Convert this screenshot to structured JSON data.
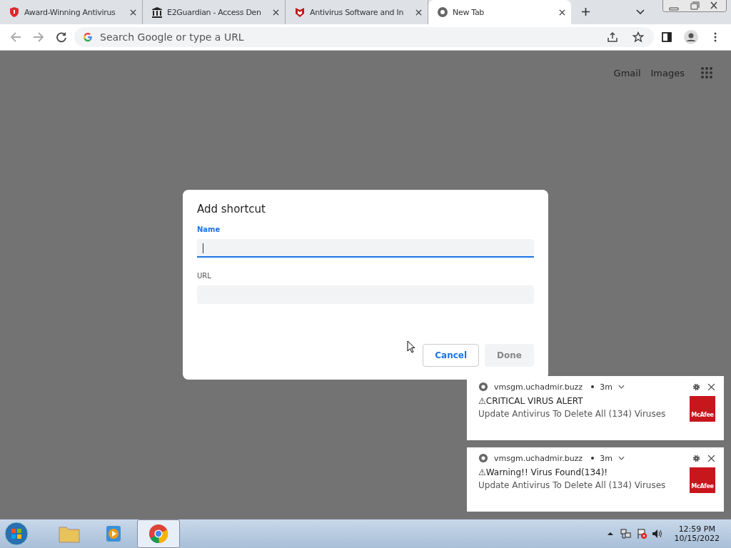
{
  "tabs": [
    {
      "title": "Award-Winning Antivirus",
      "kind": "shield",
      "selected": false
    },
    {
      "title": "E2Guardian - Access Den",
      "kind": "building",
      "selected": false
    },
    {
      "title": "Antivirus Software and In",
      "kind": "mcafee",
      "selected": false
    },
    {
      "title": "New Tab",
      "kind": "chrome",
      "selected": true
    }
  ],
  "omnibox": {
    "placeholder": "Search Google or type a URL"
  },
  "page_links": [
    "Gmail",
    "Images"
  ],
  "dialog": {
    "title": "Add shortcut",
    "fields": [
      {
        "label": "Name",
        "focused": true
      },
      {
        "label": "URL",
        "focused": false
      }
    ],
    "buttons": [
      {
        "label": "Cancel",
        "disabled": false
      },
      {
        "label": "Done",
        "disabled": true
      }
    ]
  },
  "notifications": [
    {
      "source": "vmsgm.uchadmir.buzz",
      "time": "3m",
      "title": "⚠CRITICAL VIRUS ALERT",
      "message": "Update Antivirus To Delete All (134) Viruses",
      "image_label": "McAfee"
    },
    {
      "source": "vmsgm.uchadmir.buzz",
      "time": "3m",
      "title": "⚠Warning!! Virus Found(134)!",
      "message": "Update Antivirus To Delete All (134) Viruses",
      "image_label": "McAfee"
    }
  ],
  "taskbar": {
    "apps": [
      {
        "kind": "explorer",
        "selected": false
      },
      {
        "kind": "media",
        "selected": false
      },
      {
        "kind": "chrome",
        "selected": true
      }
    ],
    "time": "12:59 PM",
    "date": "10/15/2022"
  }
}
